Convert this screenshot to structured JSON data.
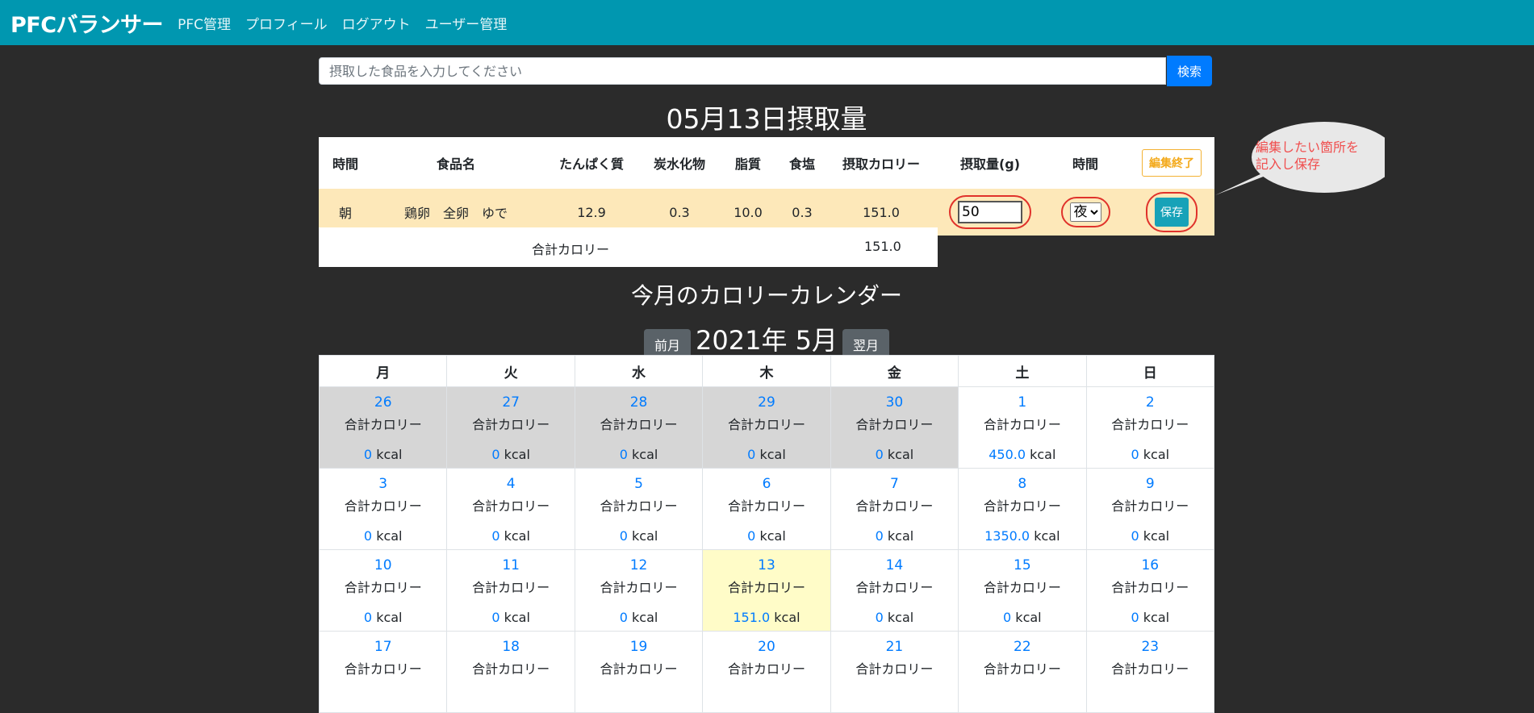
{
  "navbar": {
    "brand": "PFCバランサー",
    "links": [
      "PFC管理",
      "プロフィール",
      "ログアウト",
      "ユーザー管理"
    ]
  },
  "search": {
    "placeholder": "摂取した食品を入力してください",
    "button": "検索"
  },
  "intake": {
    "title": "05月13日摂取量",
    "headers": [
      "時間",
      "食品名",
      "たんぱく質",
      "炭水化物",
      "脂質",
      "食塩",
      "摂取カロリー",
      "摂取量(g)",
      "時間"
    ],
    "edit_done_label": "編集終了",
    "row": {
      "time": "朝",
      "food": "鶏卵　全卵　ゆで",
      "protein": "12.9",
      "carbs": "0.3",
      "fat": "10.0",
      "salt": "0.3",
      "calories": "151.0",
      "quantity": "50",
      "time_select": "夜",
      "save_label": "保存"
    },
    "total_label": "合計カロリー",
    "total_value": "151.0"
  },
  "callout": {
    "text_line1": "編集したい箇所を",
    "text_line2": "記入し保存"
  },
  "calendar": {
    "title": "今月のカロリーカレンダー",
    "prev_label": "前月",
    "next_label": "翌月",
    "month_label": "2021年 5月",
    "weekdays": [
      "月",
      "火",
      "水",
      "木",
      "金",
      "土",
      "日"
    ],
    "cell_label": "合計カロリー",
    "unit": "kcal",
    "weeks": [
      [
        {
          "day": "26",
          "kcal": "0"
        },
        {
          "day": "27",
          "kcal": "0"
        },
        {
          "day": "28",
          "kcal": "0"
        },
        {
          "day": "29",
          "kcal": "0"
        },
        {
          "day": "30",
          "kcal": "0"
        },
        {
          "day": "1",
          "kcal": "450.0"
        },
        {
          "day": "2",
          "kcal": "0"
        }
      ],
      [
        {
          "day": "3",
          "kcal": "0"
        },
        {
          "day": "4",
          "kcal": "0"
        },
        {
          "day": "5",
          "kcal": "0"
        },
        {
          "day": "6",
          "kcal": "0"
        },
        {
          "day": "7",
          "kcal": "0"
        },
        {
          "day": "8",
          "kcal": "1350.0"
        },
        {
          "day": "9",
          "kcal": "0"
        }
      ],
      [
        {
          "day": "10",
          "kcal": "0"
        },
        {
          "day": "11",
          "kcal": "0"
        },
        {
          "day": "12",
          "kcal": "0"
        },
        {
          "day": "13",
          "kcal": "151.0"
        },
        {
          "day": "14",
          "kcal": "0"
        },
        {
          "day": "15",
          "kcal": "0"
        },
        {
          "day": "16",
          "kcal": "0"
        }
      ],
      [
        {
          "day": "17",
          "kcal": ""
        },
        {
          "day": "18",
          "kcal": ""
        },
        {
          "day": "19",
          "kcal": ""
        },
        {
          "day": "20",
          "kcal": ""
        },
        {
          "day": "21",
          "kcal": ""
        },
        {
          "day": "22",
          "kcal": ""
        },
        {
          "day": "23",
          "kcal": ""
        }
      ]
    ]
  }
}
